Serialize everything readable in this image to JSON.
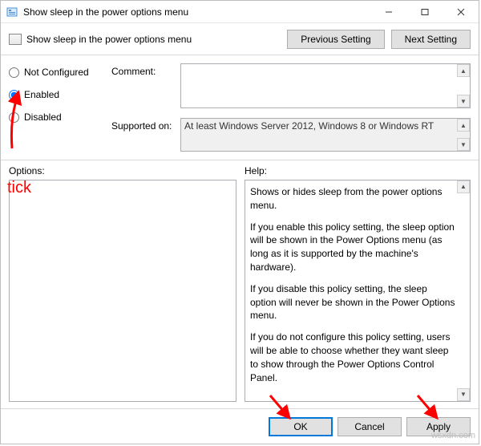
{
  "window": {
    "title": "Show sleep in the power options menu",
    "subtitle": "Show sleep in the power options menu"
  },
  "nav": {
    "prev": "Previous Setting",
    "next": "Next Setting"
  },
  "radios": {
    "not_configured": "Not Configured",
    "enabled": "Enabled",
    "disabled": "Disabled"
  },
  "labels": {
    "comment": "Comment:",
    "supported": "Supported on:",
    "supported_value": "At least Windows Server 2012, Windows 8 or Windows RT",
    "options": "Options:",
    "help": "Help:"
  },
  "help": {
    "p1": "Shows or hides sleep from the power options menu.",
    "p2": "If you enable this policy setting, the sleep option will be shown in the Power Options menu (as long as it is supported by the machine's hardware).",
    "p3": "If you disable this policy setting, the sleep option will never be shown in the Power Options menu.",
    "p4": "If you do not configure this policy setting, users will be able to choose whether they want sleep to show through the Power Options Control Panel."
  },
  "footer": {
    "ok": "OK",
    "cancel": "Cancel",
    "apply": "Apply"
  },
  "annotation": {
    "tick": "tick"
  },
  "watermark": "wsxdn.com"
}
